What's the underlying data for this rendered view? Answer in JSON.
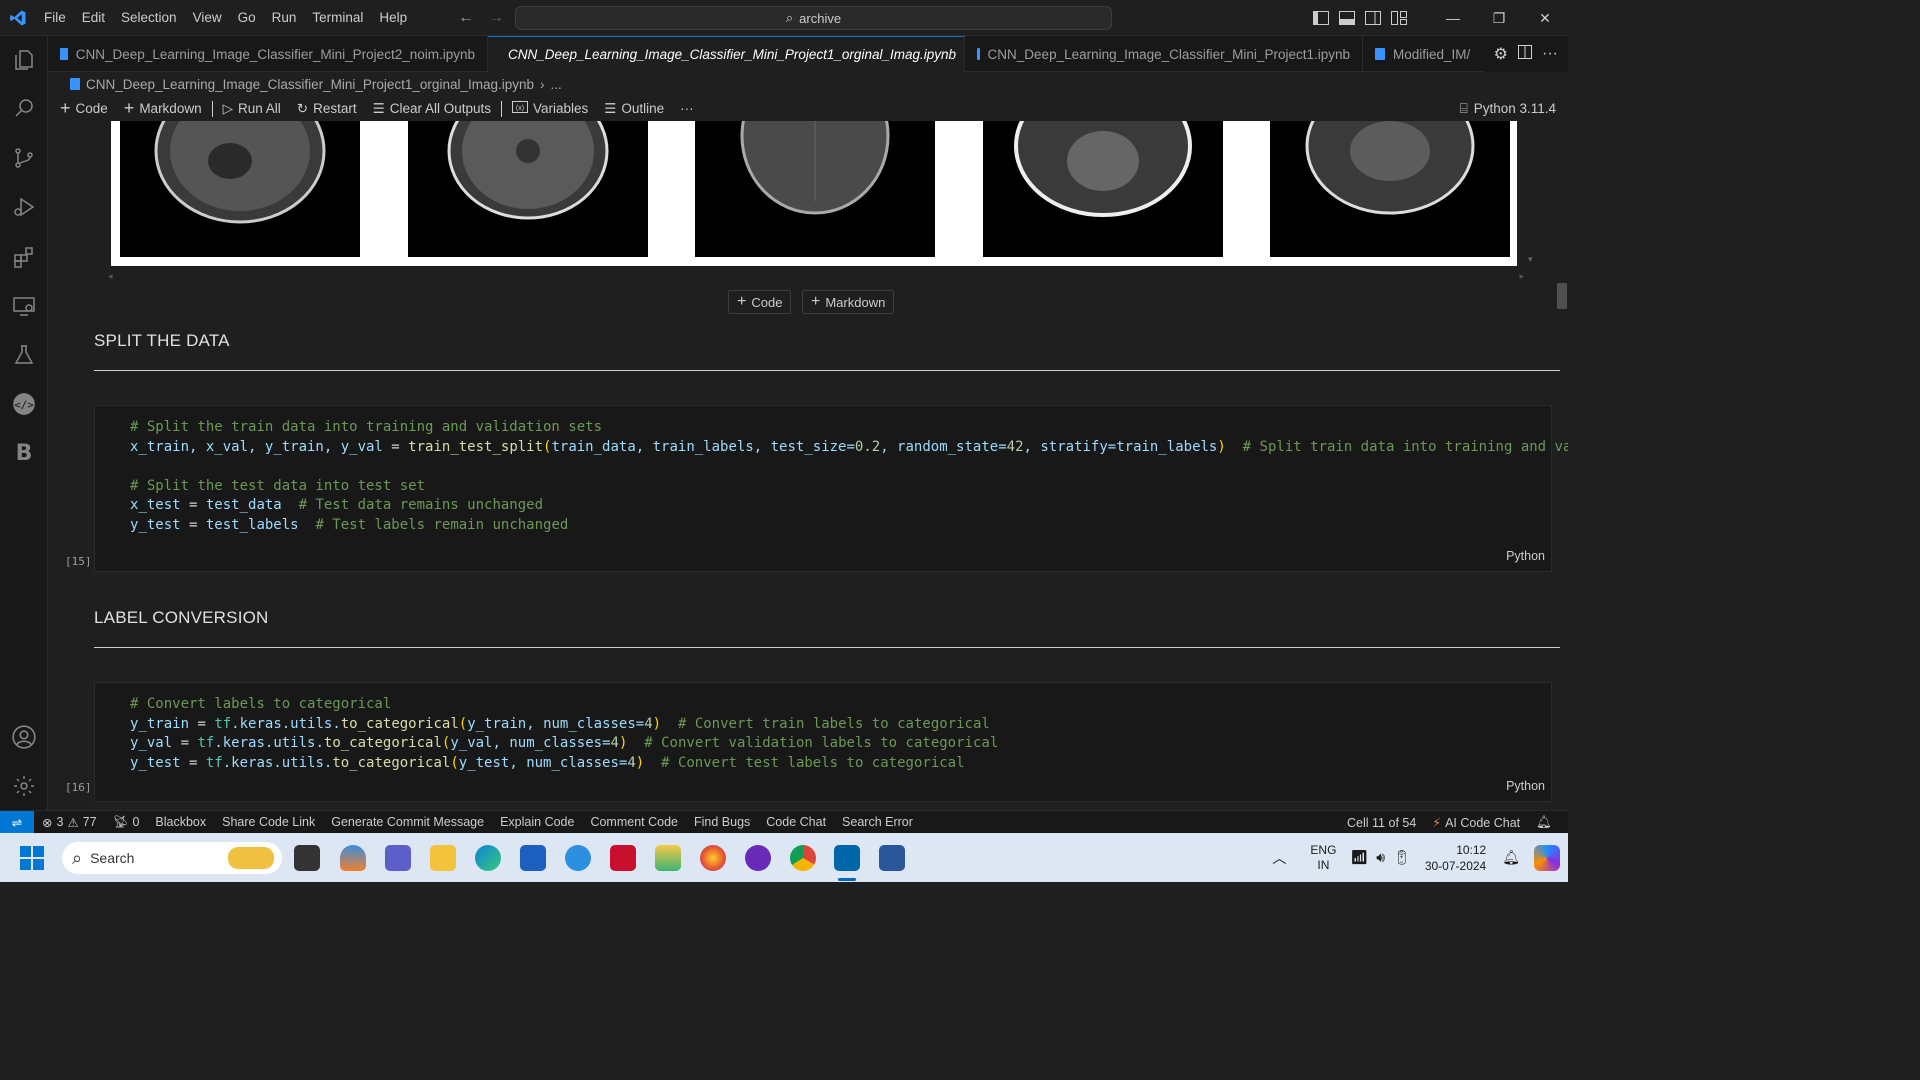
{
  "menu": [
    "File",
    "Edit",
    "Selection",
    "View",
    "Go",
    "Run",
    "Terminal",
    "Help"
  ],
  "search": {
    "text": "archive"
  },
  "tabs": [
    {
      "label": "CNN_Deep_Learning_Image_Classifier_Mini_Project2_noim.ipynb",
      "active": false
    },
    {
      "label": "CNN_Deep_Learning_Image_Classifier_Mini_Project1_orginal_Imag.ipynb",
      "active": true
    },
    {
      "label": "CNN_Deep_Learning_Image_Classifier_Mini_Project1.ipynb",
      "active": false
    },
    {
      "label": "Modified_IM/",
      "active": false
    }
  ],
  "breadcrumb": {
    "file": "CNN_Deep_Learning_Image_Classifier_Mini_Project1_orginal_Imag.ipynb",
    "more": "..."
  },
  "toolbar": {
    "code": "Code",
    "markdown": "Markdown",
    "run_all": "Run All",
    "restart": "Restart",
    "clear": "Clear All Outputs",
    "variables": "Variables",
    "outline": "Outline",
    "more": "···",
    "kernel": "Python 3.11.4"
  },
  "add_cell": {
    "code": "Code",
    "markdown": "Markdown"
  },
  "sections": [
    {
      "heading": "SPLIT THE DATA",
      "exec_count": "[15]",
      "language": "Python"
    },
    {
      "heading": "LABEL CONVERSION",
      "exec_count": "[16]",
      "language": "Python"
    }
  ],
  "code1": {
    "l1": "# Split the train data into training and validation sets",
    "l2_vars": "x_train, x_val, y_train, y_val",
    "l2_fn": "train_test_split",
    "l2_args": "train_data, train_labels, test_size=",
    "l2_n1": "0.2",
    "l2_rs": ", random_state=",
    "l2_n2": "42",
    "l2_st": ", stratify=train_labels",
    "l2_com": "# Split train data into training and validation s",
    "l4": "# Split the test data into test set",
    "l5_var": "x_test",
    "l5_val": "test_data",
    "l5_com": "# Test data remains unchanged",
    "l6_var": "y_test",
    "l6_val": "test_labels",
    "l6_com": "# Test labels remain unchanged"
  },
  "code2": {
    "l1": "# Convert labels to categorical",
    "l2_var": "y_train",
    "l2_arg": "y_train",
    "l2_com": "# Convert train labels to categorical",
    "l3_var": "y_val",
    "l3_arg": "y_val",
    "l3_com": "# Convert validation labels to categorical",
    "l4_var": "y_test",
    "l4_arg": "y_test",
    "l4_com": "# Convert test labels to categorical",
    "ns": "tf",
    "mod": ".keras.utils.",
    "fn": "to_categorical",
    "kw": ", num_classes=",
    "n": "4"
  },
  "status": {
    "errors": "3",
    "warnings": "77",
    "ports": "0",
    "items": [
      "Blackbox",
      "Share Code Link",
      "Generate Commit Message",
      "Explain Code",
      "Comment Code",
      "Find Bugs",
      "Code Chat",
      "Search Error"
    ],
    "cell": "Cell 11 of 54",
    "ai": "AI Code Chat"
  },
  "taskbar": {
    "search": "Search",
    "lang1": "ENG",
    "lang2": "IN",
    "time": "10:12",
    "date": "30-07-2024"
  },
  "colors": {
    "accent": "#0078d4",
    "background": "#1f1f1f",
    "taskbar": "#dde7f3"
  }
}
